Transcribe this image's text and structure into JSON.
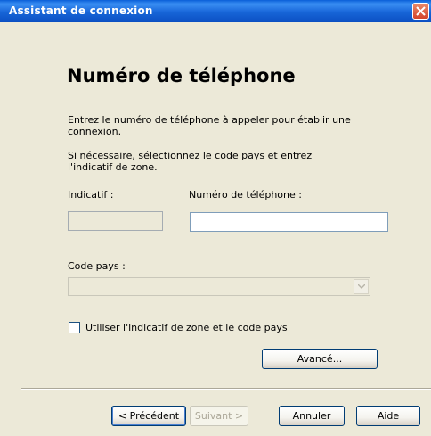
{
  "window": {
    "title": "Assistant de connexion"
  },
  "page": {
    "heading": "Numéro de téléphone",
    "description1": "Entrez le numéro de téléphone à appeler pour établir une connexion.",
    "description2": "Si nécessaire, sélectionnez le code pays et entrez l'indicatif de zone."
  },
  "form": {
    "area_code_label": "Indicatif :",
    "area_code_value": "",
    "phone_label": "Numéro de téléphone :",
    "phone_value": "",
    "country_label": "Code pays :",
    "country_value": "",
    "use_area_code_label": "Utiliser l'indicatif de zone et le code pays",
    "use_area_code_checked": false,
    "advanced_button": "Avancé..."
  },
  "buttons": {
    "previous": "< Précédent",
    "next": "Suivant >",
    "cancel": "Annuler",
    "help": "Aide"
  },
  "colors": {
    "titlebar": "#0b4fc2",
    "dialog_bg": "#ece9d8",
    "close": "#d4442a"
  }
}
